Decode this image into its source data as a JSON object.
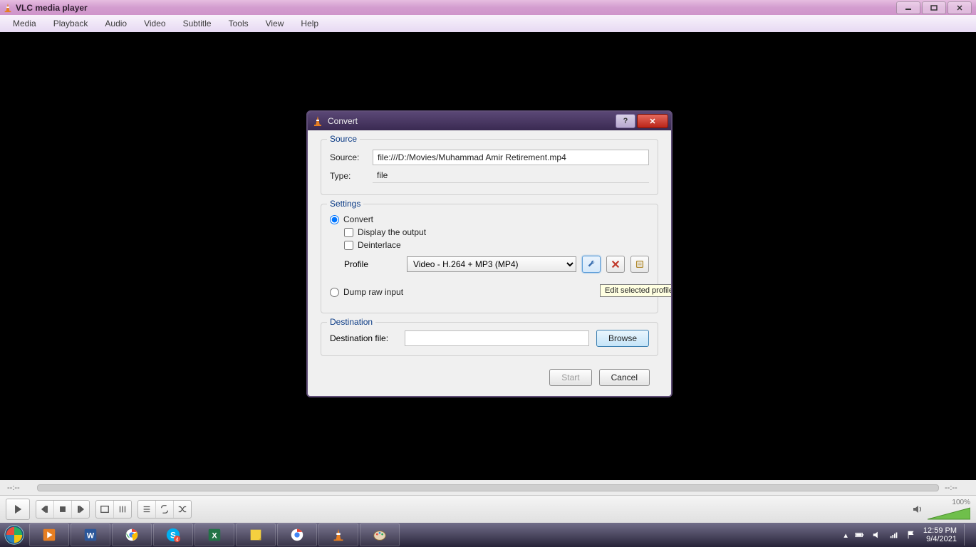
{
  "app": {
    "title": "VLC media player"
  },
  "menus": {
    "media": "Media",
    "playback": "Playback",
    "audio": "Audio",
    "video": "Video",
    "subtitle": "Subtitle",
    "tools": "Tools",
    "view": "View",
    "help": "Help"
  },
  "time": {
    "elapsed": "--:--",
    "remain": "--:--"
  },
  "dialog": {
    "title": "Convert",
    "source_legend": "Source",
    "source_label": "Source:",
    "source_value": "file:///D:/Movies/Muhammad Amir Retirement.mp4",
    "type_label": "Type:",
    "type_value": "file",
    "settings_legend": "Settings",
    "convert_label": "Convert",
    "display_label": "Display the output",
    "deinterlace_label": "Deinterlace",
    "profile_label": "Profile",
    "profile_value": "Video - H.264 + MP3 (MP4)",
    "dump_label": "Dump raw input",
    "tooltip": "Edit selected profile",
    "dest_legend": "Destination",
    "dest_file_label": "Destination file:",
    "dest_file_value": "",
    "browse": "Browse",
    "start": "Start",
    "cancel": "Cancel"
  },
  "volume_pct": "100%",
  "system": {
    "time": "12:59 PM",
    "date": "9/4/2021"
  }
}
